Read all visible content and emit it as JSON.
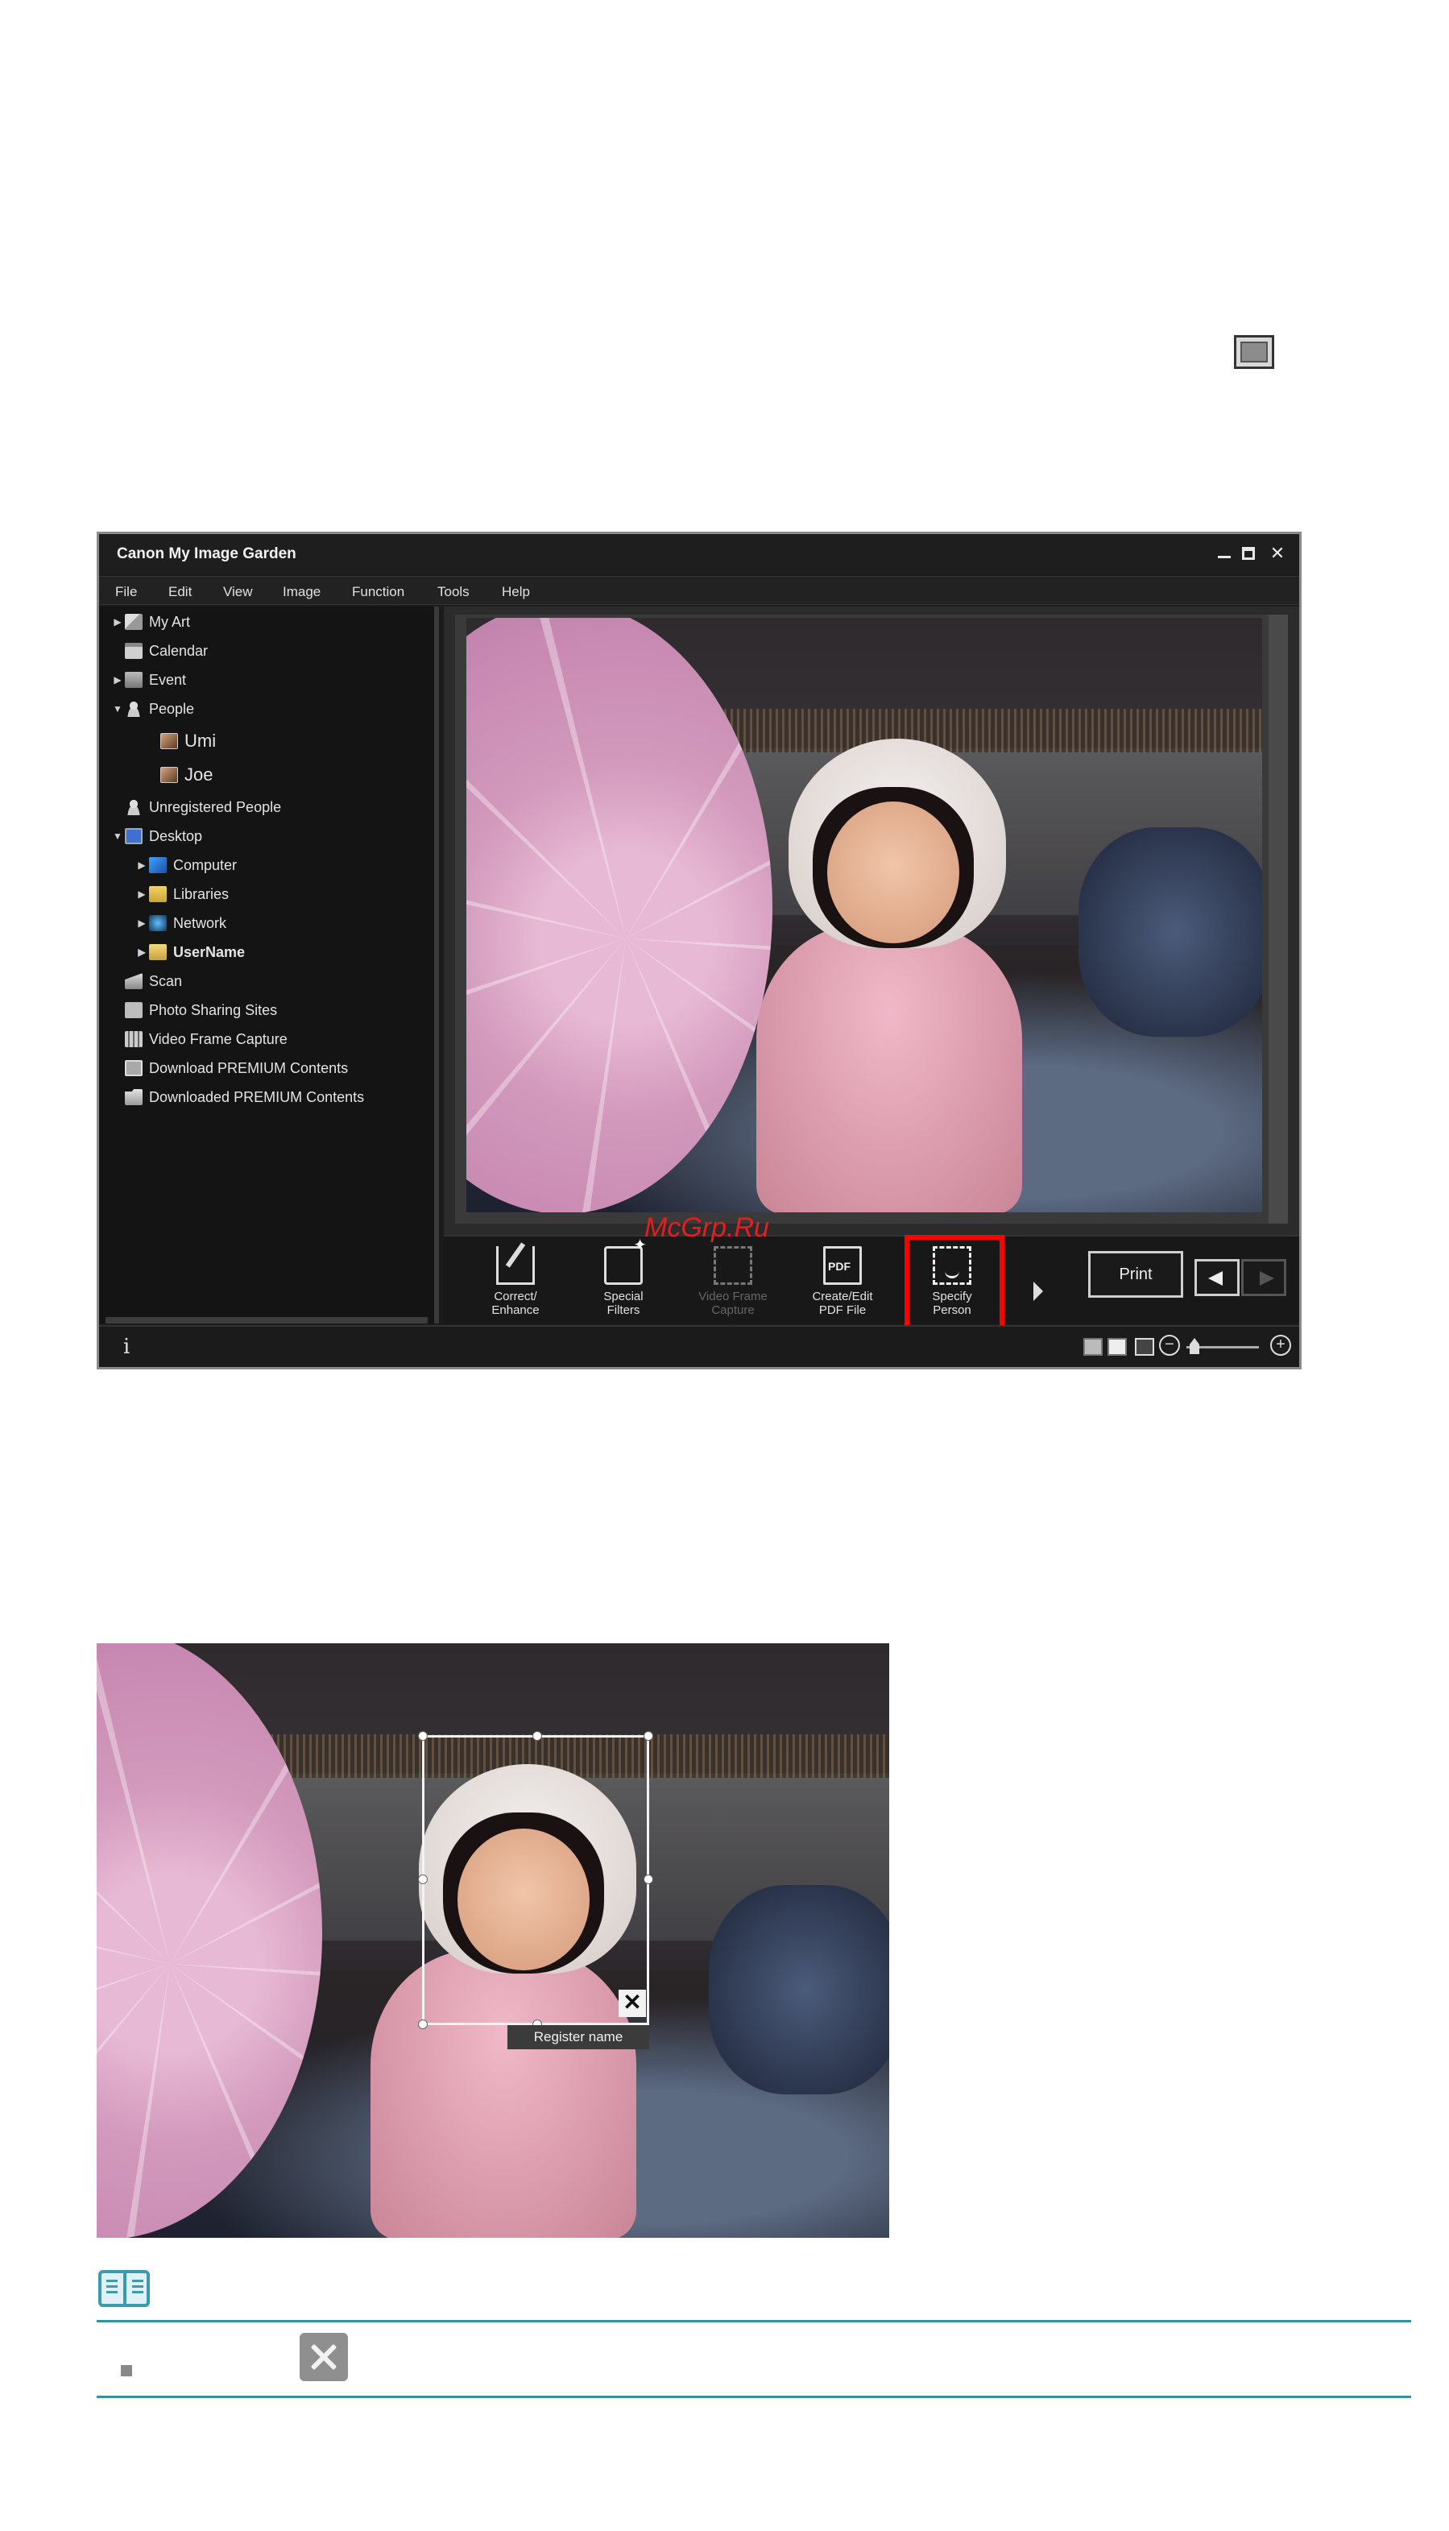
{
  "window": {
    "title": "Canon My Image Garden",
    "controls": {
      "minimize": "",
      "maximize": "",
      "close": "✕"
    }
  },
  "menu": [
    "File",
    "Edit",
    "View",
    "Image",
    "Function",
    "Tools",
    "Help"
  ],
  "tree": {
    "my_art": "My Art",
    "calendar": "Calendar",
    "event": "Event",
    "people": "People",
    "person_1": "Umi",
    "person_2": "Joe",
    "unregistered": "Unregistered People",
    "desktop": "Desktop",
    "computer": "Computer",
    "libraries": "Libraries",
    "network": "Network",
    "username": "UserName",
    "scan": "Scan",
    "photo_sharing": "Photo Sharing Sites",
    "video_capture": "Video Frame Capture",
    "download_premium": "Download PREMIUM Contents",
    "downloaded_premium": "Downloaded PREMIUM Contents"
  },
  "toolbar": {
    "correct_line1": "Correct/",
    "correct_line2": "Enhance",
    "special_line1": "Special",
    "special_line2": "Filters",
    "video_line1": "Video Frame",
    "video_line2": "Capture",
    "pdf_line1": "Create/Edit",
    "pdf_line2": "PDF File",
    "specify_line1": "Specify",
    "specify_line2": "Person",
    "print": "Print"
  },
  "status": {
    "info": "i",
    "zoom_minus": "−",
    "zoom_plus": "+"
  },
  "watermark": "McGrp.Ru",
  "face_box": {
    "close": "✕",
    "register_label": "Register name"
  }
}
